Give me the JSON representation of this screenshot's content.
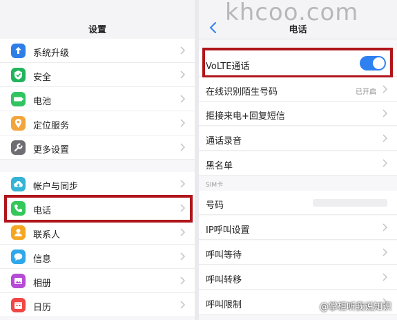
{
  "left": {
    "title": "设置",
    "items": [
      {
        "label": "系统升级",
        "icon": "system-update-icon",
        "color": "#2f7de6"
      },
      {
        "label": "安全",
        "icon": "security-shield-icon",
        "color": "#22b45c"
      },
      {
        "label": "电池",
        "icon": "battery-icon",
        "color": "#31c460"
      },
      {
        "label": "定位服务",
        "icon": "location-pin-icon",
        "color": "#f2a53a"
      },
      {
        "label": "更多设置",
        "icon": "wrench-icon",
        "color": "#6d6d72"
      },
      {
        "label": "帐户与同步",
        "icon": "cloud-sync-icon",
        "color": "#34b3d6"
      },
      {
        "label": "电话",
        "icon": "phone-icon",
        "color": "#34c759"
      },
      {
        "label": "联系人",
        "icon": "contacts-icon",
        "color": "#f5a623"
      },
      {
        "label": "信息",
        "icon": "message-bubble-icon",
        "color": "#2ea8ea"
      },
      {
        "label": "相册",
        "icon": "album-icon",
        "color": "#b64bd6"
      },
      {
        "label": "日历",
        "icon": "calendar-icon",
        "color": "#f04646"
      }
    ]
  },
  "right": {
    "title": "电话",
    "watermark": "khcoo.com",
    "volte": {
      "label": "VoLTE通话",
      "enabled": true
    },
    "items": [
      {
        "label": "在线识别陌生号码",
        "value": "已开启"
      },
      {
        "label": "拒接来电+回复短信",
        "value": ""
      },
      {
        "label": "通话录音",
        "value": ""
      },
      {
        "label": "黑名单",
        "value": ""
      }
    ],
    "sim_section": "SIM卡",
    "sim_items": [
      {
        "label": "号码"
      },
      {
        "label": "IP呼叫设置"
      },
      {
        "label": "呼叫等待"
      },
      {
        "label": "呼叫转移"
      },
      {
        "label": "呼叫限制"
      }
    ]
  },
  "credit": "@掌柜听我说知识",
  "colors": {
    "highlight": "#b0151b",
    "toggle_on": "#2f80f0"
  }
}
